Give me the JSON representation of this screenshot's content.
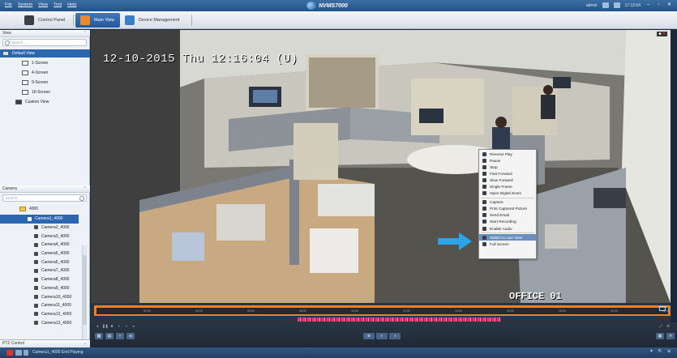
{
  "window": {
    "menu": [
      "File",
      "System",
      "View",
      "Tool",
      "Help"
    ],
    "title": "NVMS7000",
    "user": "admin",
    "clock": "17:12:54"
  },
  "tabs": [
    {
      "label": "Control Panel"
    },
    {
      "label": "Main View"
    },
    {
      "label": "Device Management"
    }
  ],
  "view_panel": {
    "header": "View",
    "search_placeholder": "Search...",
    "items": [
      "Default View",
      "1-Screen",
      "4-Screen",
      "9-Screen",
      "16-Screen",
      "Custom View"
    ]
  },
  "camera_panel": {
    "header": "Camera",
    "search_placeholder": "Search...",
    "group": "4000",
    "cameras": [
      "Camera1_4000",
      "Camera2_4000",
      "Camera3_4000",
      "Camera4_4000",
      "Camera5_4000",
      "Camera6_4000",
      "Camera7_4000",
      "Camera8_4000",
      "Camera9_4000",
      "Camera10_4000",
      "Camera11_4000",
      "Camera12_4000",
      "Camera13_4000"
    ]
  },
  "video": {
    "osd_time": "12-10-2015 Thu 12:16:04 (U)",
    "osd_name": "OFFICE 01"
  },
  "context_menu": {
    "items": [
      "Reverse Play",
      "Pause",
      "Stop",
      "Fast Forward",
      "Slow Forward",
      "Single Frame",
      "Open Digital Zoom",
      "Capture",
      "Print Captured Picture",
      "Send Email",
      "Start Recording",
      "Enable Audio",
      "Switch to Live View",
      "Full Screen"
    ],
    "highlighted": "Switch to Live View"
  },
  "timeline": {
    "ticks": [
      "02:00",
      "04:00",
      "06:00",
      "08:00",
      "10:00",
      "12:00",
      "14:00",
      "16:00",
      "18:00",
      "20:00",
      "22:00"
    ]
  },
  "ptz": {
    "header": "PTZ Control"
  },
  "status": {
    "message": "Camera1_4000 End Playing"
  },
  "colors": {
    "accent": "#2d66b0",
    "timeline_border": "#ef7f24",
    "record_bar": "#d8436a",
    "arrow": "#2aa6e8"
  }
}
